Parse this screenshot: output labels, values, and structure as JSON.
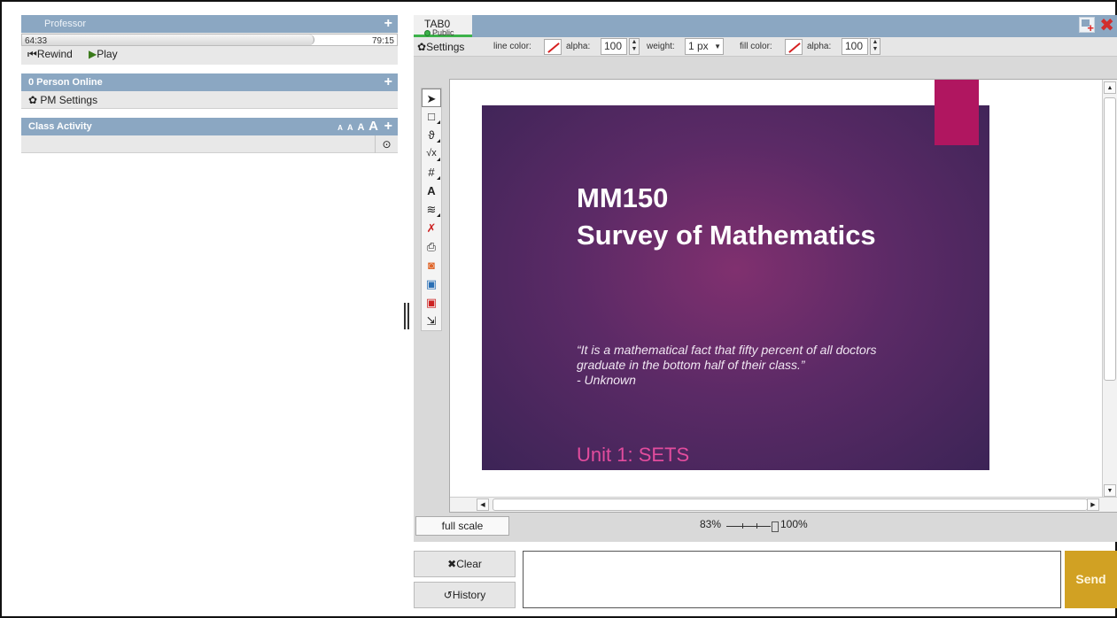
{
  "professor_panel": {
    "title": "Professor",
    "current_time": "64:33",
    "total_time": "79:15",
    "progress": 0.78,
    "rewind_label": "Rewind",
    "play_label": "Play"
  },
  "online_panel": {
    "title": "0 Person Online",
    "pm_settings_label": "PM Settings"
  },
  "class_activity": {
    "title": "Class Activity",
    "font_sizes": [
      "A",
      "A",
      "A",
      "A"
    ]
  },
  "whiteboard": {
    "tab": {
      "name": "TAB0",
      "status": "Public"
    },
    "toolbar": {
      "settings_label": "Settings",
      "line_color_label": "line color:",
      "alpha_label": "alpha:",
      "line_alpha": "100",
      "weight_label": "weight:",
      "weight_value": "1 px",
      "fill_color_label": "fill color:",
      "fill_alpha_label": "alpha:",
      "fill_alpha": "100"
    },
    "tools": [
      "select",
      "rectangle",
      "freehand",
      "equation",
      "grid",
      "text",
      "layers",
      "delete",
      "print",
      "timer",
      "user",
      "user-remove",
      "import"
    ],
    "slide": {
      "title": "MM150\nSurvey of Mathematics",
      "quote": "“It is a mathematical fact that fifty percent of all doctors\ngraduate in the bottom half of their class.”\n - Unknown",
      "unit": "Unit 1: SETS"
    },
    "zoom": {
      "full_scale_label": "full scale",
      "min_label": "83%",
      "max_label": "100%",
      "level": 1.0
    }
  },
  "chat": {
    "clear_label": "Clear",
    "history_label": "History",
    "send_label": "Send",
    "input_value": ""
  },
  "colors": {
    "panel_header": "#8ba7c2",
    "public_green": "#3cb24a",
    "send_gold": "#d1a123",
    "slide_accent": "#b01660",
    "unit_pink": "#e24c9d"
  }
}
